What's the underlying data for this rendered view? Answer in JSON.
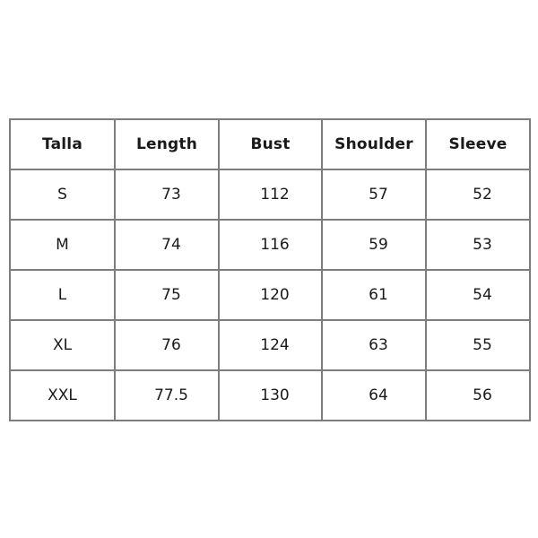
{
  "table": {
    "columns": [
      "Talla",
      "Length",
      "Bust",
      "Shoulder",
      "Sleeve"
    ],
    "rows": [
      {
        "size": "S",
        "length": "73",
        "bust": "112",
        "shoulder": "57",
        "sleeve": "52"
      },
      {
        "size": "M",
        "length": "74",
        "bust": "116",
        "shoulder": "59",
        "sleeve": "53"
      },
      {
        "size": "L",
        "length": "75",
        "bust": "120",
        "shoulder": "61",
        "sleeve": "54"
      },
      {
        "size": "XL",
        "length": "76",
        "bust": "124",
        "shoulder": "63",
        "sleeve": "55"
      },
      {
        "size": "XXL",
        "length": "77.5",
        "bust": "130",
        "shoulder": "64",
        "sleeve": "56"
      }
    ]
  },
  "colors": {
    "background": "#ffffff",
    "border": "#7d7d7d",
    "text": "#1a1a1a"
  }
}
